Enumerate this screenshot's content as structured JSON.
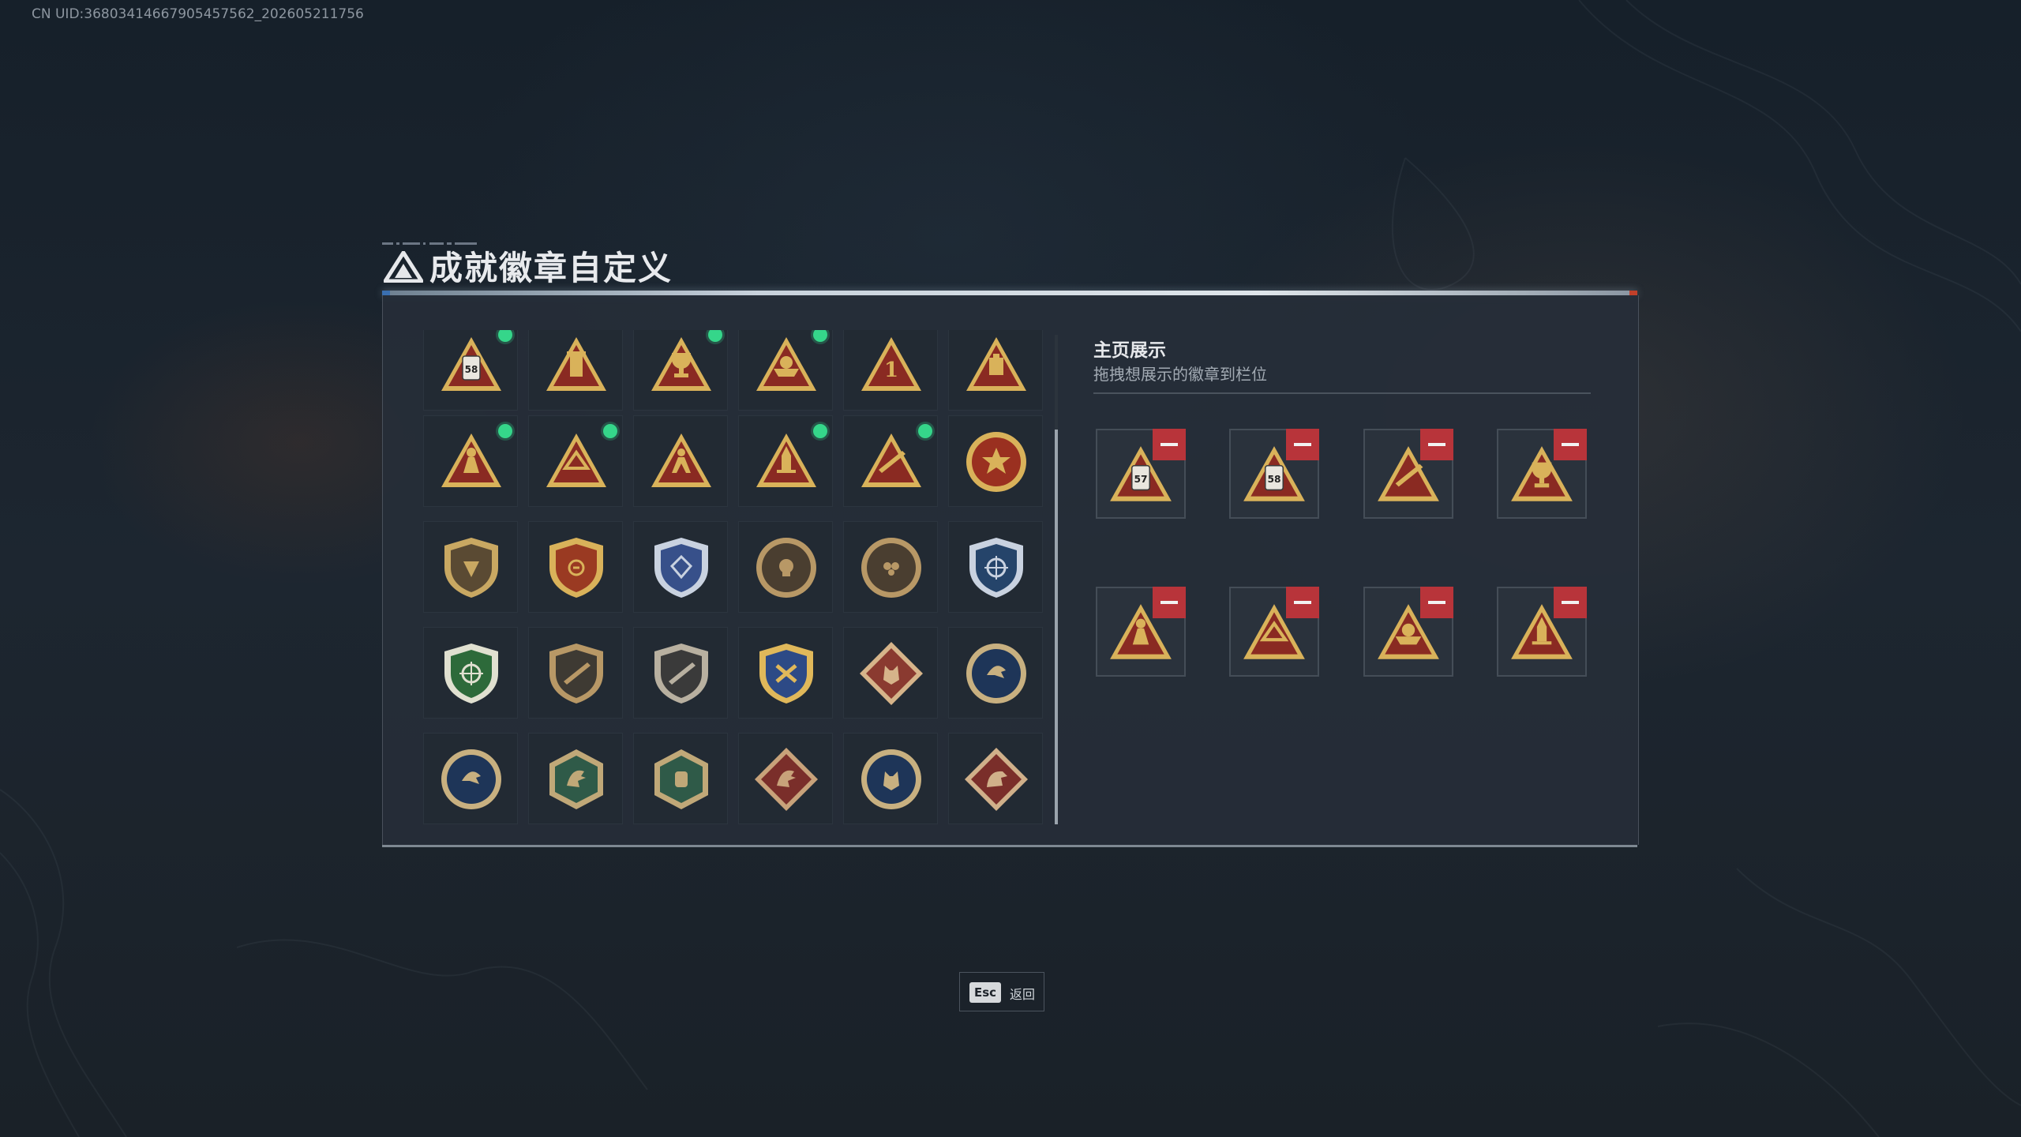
{
  "uid_text": "CN UID:3680341466790545756​2_202605211756",
  "header": {
    "title": "成就徽章自定义"
  },
  "badge_grid": {
    "badges": [
      {
        "name": "badge-58-triangle-red",
        "shape": "triangle",
        "base": "#8a2a22",
        "rim": "#d9b25a",
        "emblem": "58",
        "new": true
      },
      {
        "name": "badge-tower-triangle",
        "shape": "triangle",
        "base": "#8a2a22",
        "rim": "#d9b25a",
        "emblem": "tower",
        "new": false
      },
      {
        "name": "badge-trophy-triangle",
        "shape": "triangle",
        "base": "#8a2a22",
        "rim": "#d9b25a",
        "emblem": "trophy",
        "new": true
      },
      {
        "name": "badge-boat-triangle",
        "shape": "triangle",
        "base": "#8a2a22",
        "rim": "#d9b25a",
        "emblem": "boat",
        "new": true
      },
      {
        "name": "badge-number-1-triangle",
        "shape": "triangle",
        "base": "#8a2a22",
        "rim": "#d9b25a",
        "emblem": "1",
        "new": false
      },
      {
        "name": "badge-box-triangle",
        "shape": "triangle",
        "base": "#8a2a22",
        "rim": "#d9b25a",
        "emblem": "box",
        "new": false
      },
      {
        "name": "badge-soldier-triangle",
        "shape": "triangle",
        "base": "#8a2a22",
        "rim": "#d9b25a",
        "emblem": "soldier",
        "new": true
      },
      {
        "name": "badge-hands-triangle",
        "shape": "triangle",
        "base": "#8a2a22",
        "rim": "#d9b25a",
        "emblem": "hands",
        "new": true
      },
      {
        "name": "badge-figure-triangle",
        "shape": "triangle",
        "base": "#8a2a22",
        "rim": "#d9b25a",
        "emblem": "figure",
        "new": false
      },
      {
        "name": "badge-rocket-triangle",
        "shape": "triangle",
        "base": "#8a2a22",
        "rim": "#d9b25a",
        "emblem": "rocket",
        "new": true
      },
      {
        "name": "badge-rifle-triangle",
        "shape": "triangle",
        "base": "#8a2a22",
        "rim": "#d9b25a",
        "emblem": "rifle",
        "new": true
      },
      {
        "name": "badge-star-medal",
        "shape": "circle",
        "base": "#9a3020",
        "rim": "#d9b25a",
        "emblem": "star",
        "new": false
      },
      {
        "name": "badge-bronze-shield",
        "shape": "shield",
        "base": "#5a4a33",
        "rim": "#c9a862",
        "emblem": "wing",
        "new": false
      },
      {
        "name": "badge-red-gold-shield",
        "shape": "shield",
        "base": "#9a3a22",
        "rim": "#d9b25a",
        "emblem": "bolt",
        "new": false
      },
      {
        "name": "badge-blue-silver-shield",
        "shape": "shield",
        "base": "#37508a",
        "rim": "#c9d2e0",
        "emblem": "gem",
        "new": false
      },
      {
        "name": "badge-bronze-skull-coin",
        "shape": "circle",
        "base": "#4a3e30",
        "rim": "#b89866",
        "emblem": "skull",
        "new": false
      },
      {
        "name": "badge-bronze-mask-coin",
        "shape": "circle",
        "base": "#4a3e30",
        "rim": "#b89866",
        "emblem": "mask",
        "new": false
      },
      {
        "name": "badge-blue-crosshair-shield",
        "shape": "shield",
        "base": "#25446a",
        "rim": "#c9d2e0",
        "emblem": "crosshair",
        "new": false
      },
      {
        "name": "badge-green-crosshair-shield",
        "shape": "shield",
        "base": "#2d6a3a",
        "rim": "#e0e0d0",
        "emblem": "crosshair",
        "new": false
      },
      {
        "name": "badge-bronze-rifle-shield",
        "shape": "shield",
        "base": "#3e3a33",
        "rim": "#b89866",
        "emblem": "rifle",
        "new": false
      },
      {
        "name": "badge-silver-rifle-shield",
        "shape": "shield",
        "base": "#3a3a3a",
        "rim": "#b8b0a0",
        "emblem": "rifle",
        "new": false
      },
      {
        "name": "badge-blue-gold-cross-shield",
        "shape": "shield",
        "base": "#2d4a86",
        "rim": "#e0b85a",
        "emblem": "cross",
        "new": false
      },
      {
        "name": "badge-wolf-diamond",
        "shape": "diamond",
        "base": "#8a3a30",
        "rim": "#d6b48a",
        "emblem": "wolf",
        "new": false
      },
      {
        "name": "badge-eagle-blue-coin",
        "shape": "circle",
        "base": "#1e3558",
        "rim": "#c8b080",
        "emblem": "eagle",
        "new": false
      },
      {
        "name": "badge-eagle-blue-coin-2",
        "shape": "circle",
        "base": "#1e3558",
        "rim": "#c8b080",
        "emblem": "eagle",
        "new": false
      },
      {
        "name": "badge-dragon-green-hex",
        "shape": "hexagon",
        "base": "#2f5a48",
        "rim": "#c0a878",
        "emblem": "dragon",
        "new": false
      },
      {
        "name": "badge-fist-green-hex",
        "shape": "hexagon",
        "base": "#2f5a48",
        "rim": "#c0a878",
        "emblem": "fist",
        "new": false
      },
      {
        "name": "badge-dragon-red-diamond",
        "shape": "diamond",
        "base": "#7a2e2a",
        "rim": "#c8a27a",
        "emblem": "dragon",
        "new": false
      },
      {
        "name": "badge-wolf-blue-coin",
        "shape": "circle",
        "base": "#1e3558",
        "rim": "#c8b080",
        "emblem": "wolf",
        "new": false
      },
      {
        "name": "badge-dino-red-diamond",
        "shape": "diamond",
        "base": "#7a2e2a",
        "rim": "#d0b08a",
        "emblem": "dino",
        "new": false
      }
    ]
  },
  "showcase": {
    "title": "主页展示",
    "subtitle": "拖拽想展示的徽章到栏位",
    "slots": [
      {
        "name": "slot-badge-57",
        "emblem": "57"
      },
      {
        "name": "slot-badge-58",
        "emblem": "58"
      },
      {
        "name": "slot-badge-rifle",
        "emblem": "rifle"
      },
      {
        "name": "slot-badge-trophy",
        "emblem": "trophy"
      },
      {
        "name": "slot-badge-soldier",
        "emblem": "soldier"
      },
      {
        "name": "slot-badge-hands",
        "emblem": "hands"
      },
      {
        "name": "slot-badge-boat",
        "emblem": "boat"
      },
      {
        "name": "slot-badge-rocket",
        "emblem": "rocket"
      }
    ]
  },
  "footer": {
    "esc_key": "Esc",
    "back_label": "返回"
  }
}
